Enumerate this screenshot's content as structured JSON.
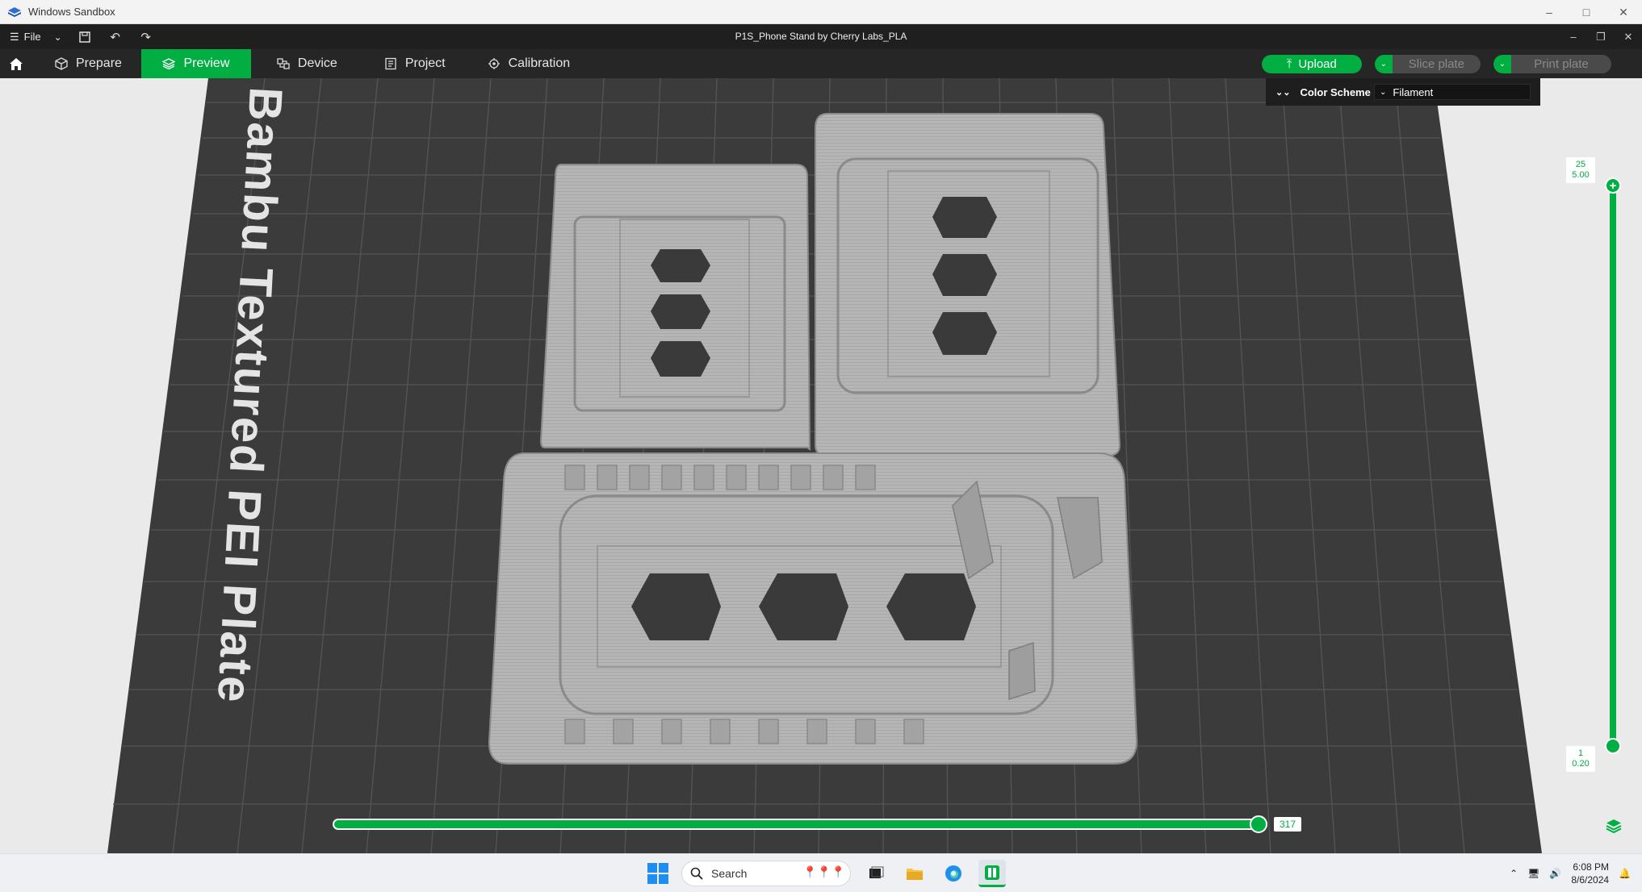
{
  "sandbox": {
    "title": "Windows Sandbox"
  },
  "app": {
    "file_label": "File",
    "document_title": "P1S_Phone Stand by Cherry Labs_PLA"
  },
  "nav": {
    "tabs": [
      {
        "label": "Prepare",
        "active": false
      },
      {
        "label": "Preview",
        "active": true
      },
      {
        "label": "Device",
        "active": false
      },
      {
        "label": "Project",
        "active": false
      },
      {
        "label": "Calibration",
        "active": false
      }
    ],
    "upload_label": "Upload",
    "slice_label": "Slice plate",
    "print_label": "Print plate"
  },
  "viewport": {
    "plate_label": "Bambu Textured PEI Plate",
    "color_scheme_label": "Color Scheme",
    "color_scheme_value": "Filament",
    "layer_top_index": "25",
    "layer_top_height": "5.00",
    "layer_bottom_index": "1",
    "layer_bottom_height": "0.20",
    "move_value": "317"
  },
  "taskbar": {
    "search_placeholder": "Search",
    "time": "6:08 PM",
    "date": "8/6/2024"
  },
  "colors": {
    "accent": "#00ae42",
    "plate": "#3b3b3b",
    "model": "#b8b8b8"
  }
}
